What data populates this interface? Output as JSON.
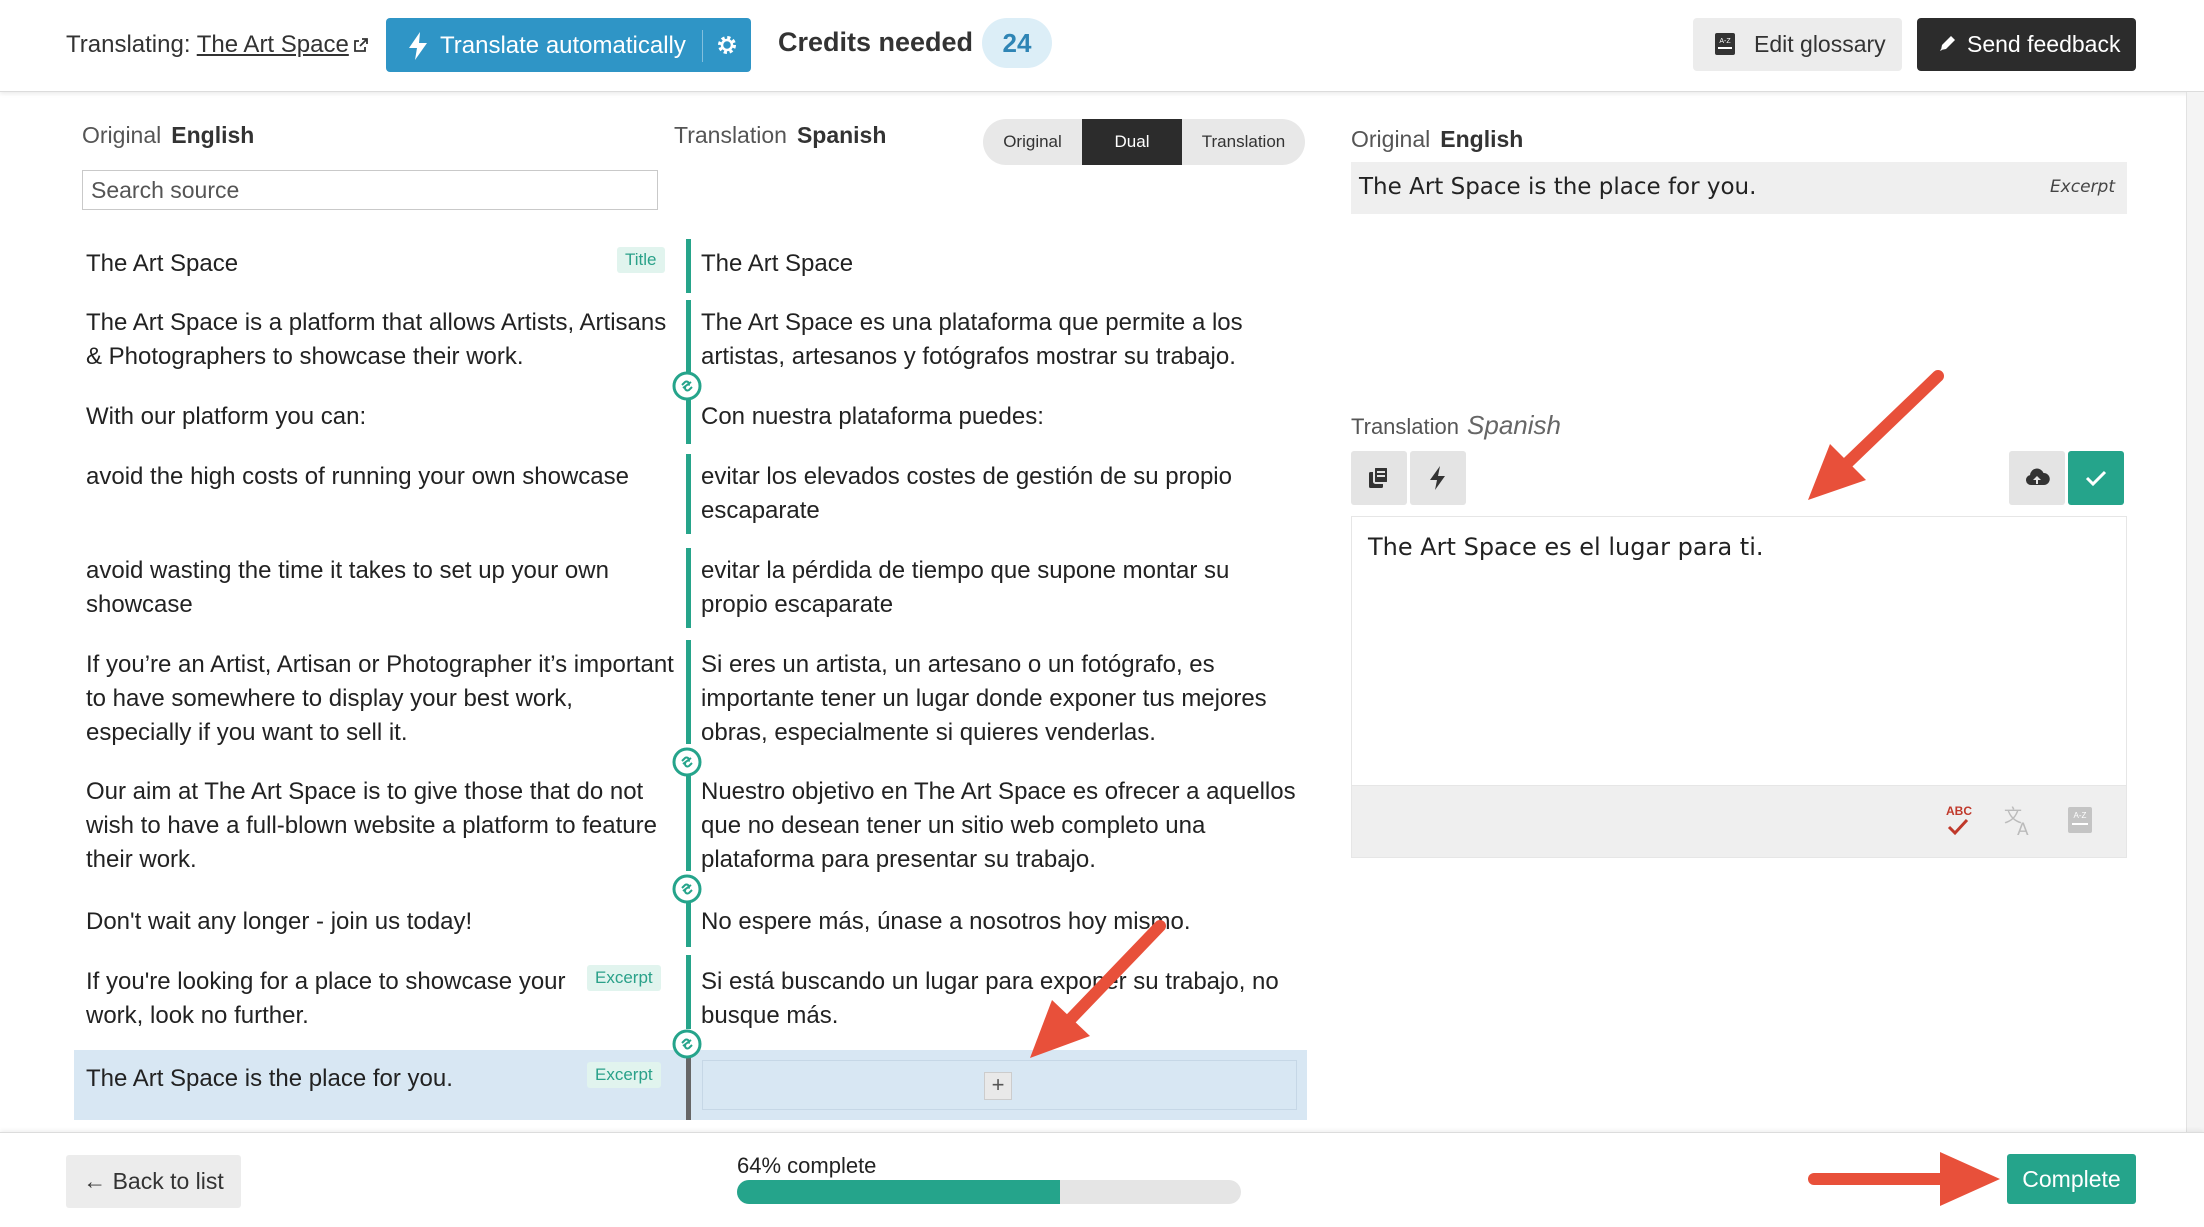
{
  "header": {
    "translating_prefix": "Translating:",
    "site_name": "The Art Space",
    "translate_auto_label": "Translate automatically",
    "credits_label": "Credits needed",
    "credits_value": "24",
    "edit_glossary_label": "Edit glossary",
    "send_feedback_label": "Send feedback"
  },
  "columns": {
    "original_prefix": "Original",
    "original_lang": "English",
    "translation_prefix": "Translation",
    "translation_lang": "Spanish",
    "search_placeholder": "Search source"
  },
  "view_toggle": {
    "options": [
      "Original",
      "Dual",
      "Translation"
    ],
    "selected": "Dual"
  },
  "segments": [
    {
      "source": "The Art Space",
      "target": "The Art Space",
      "tag": "Title"
    },
    {
      "source": "The Art Space is a platform that allows Artists, Artisans & Photographers to showcase their work.",
      "target": "The Art Space es una plataforma que permite a los artistas, artesanos y fotógrafos mostrar su trabajo.",
      "tag": ""
    },
    {
      "source": "With our platform you can:",
      "target": "Con nuestra plataforma puedes:",
      "tag": ""
    },
    {
      "source": "avoid the high costs of running your own showcase",
      "target": "evitar los elevados costes de gestión de su propio escaparate",
      "tag": ""
    },
    {
      "source": "avoid wasting the time it takes to set up your own showcase",
      "target": "evitar la pérdida de tiempo que supone montar su propio escaparate",
      "tag": ""
    },
    {
      "source": "If you’re an Artist, Artisan or Photographer it’s important to have somewhere to display your best work, especially if you want to sell it.",
      "target": "Si eres un artista, un artesano o un fotógrafo, es importante tener un lugar donde exponer tus mejores obras, especialmente si quieres venderlas.",
      "tag": ""
    },
    {
      "source": "Our aim at The Art Space is to give those that do not wish to have a full-blown website a platform to feature their work.",
      "target": "Nuestro objetivo en The Art Space es ofrecer a aquellos que no desean tener un sitio web completo una plataforma para presentar su trabajo.",
      "tag": ""
    },
    {
      "source": "Don't wait any longer - join us today!",
      "target": "No espere más, únase a nosotros hoy mismo.",
      "tag": ""
    },
    {
      "source": "If you're looking for a place to showcase your work, look no further.",
      "target": "Si está buscando un lugar para exponer su trabajo, no busque más.",
      "tag": "Excerpt"
    },
    {
      "source": "The Art Space is the place for you.",
      "target": "",
      "tag": "Excerpt"
    }
  ],
  "add_button_label": "+",
  "editor": {
    "original_prefix": "Original",
    "original_lang": "English",
    "original_text": "The Art Space is the place for you.",
    "original_tag": "Excerpt",
    "translation_prefix": "Translation",
    "translation_lang": "Spanish",
    "translation_text": "The Art Space es el lugar para ti.",
    "spellcheck_badge": "ABC"
  },
  "footer": {
    "back_label": "← Back to list",
    "progress_label": "64% complete",
    "progress_percent": 64,
    "complete_label": "Complete"
  },
  "colors": {
    "accent_teal": "#25a48b",
    "header_blue": "#2f95c6",
    "dark": "#2c2c2c",
    "annotation_arrow": "#e8503a"
  },
  "icons": [
    "external-link-icon",
    "bolt-icon",
    "gear-icon",
    "glossary-icon",
    "pencil-icon",
    "link-icon",
    "copy-icon",
    "cloud-upload-icon",
    "check-icon",
    "spellcheck-icon",
    "translate-icon",
    "plus-icon"
  ]
}
